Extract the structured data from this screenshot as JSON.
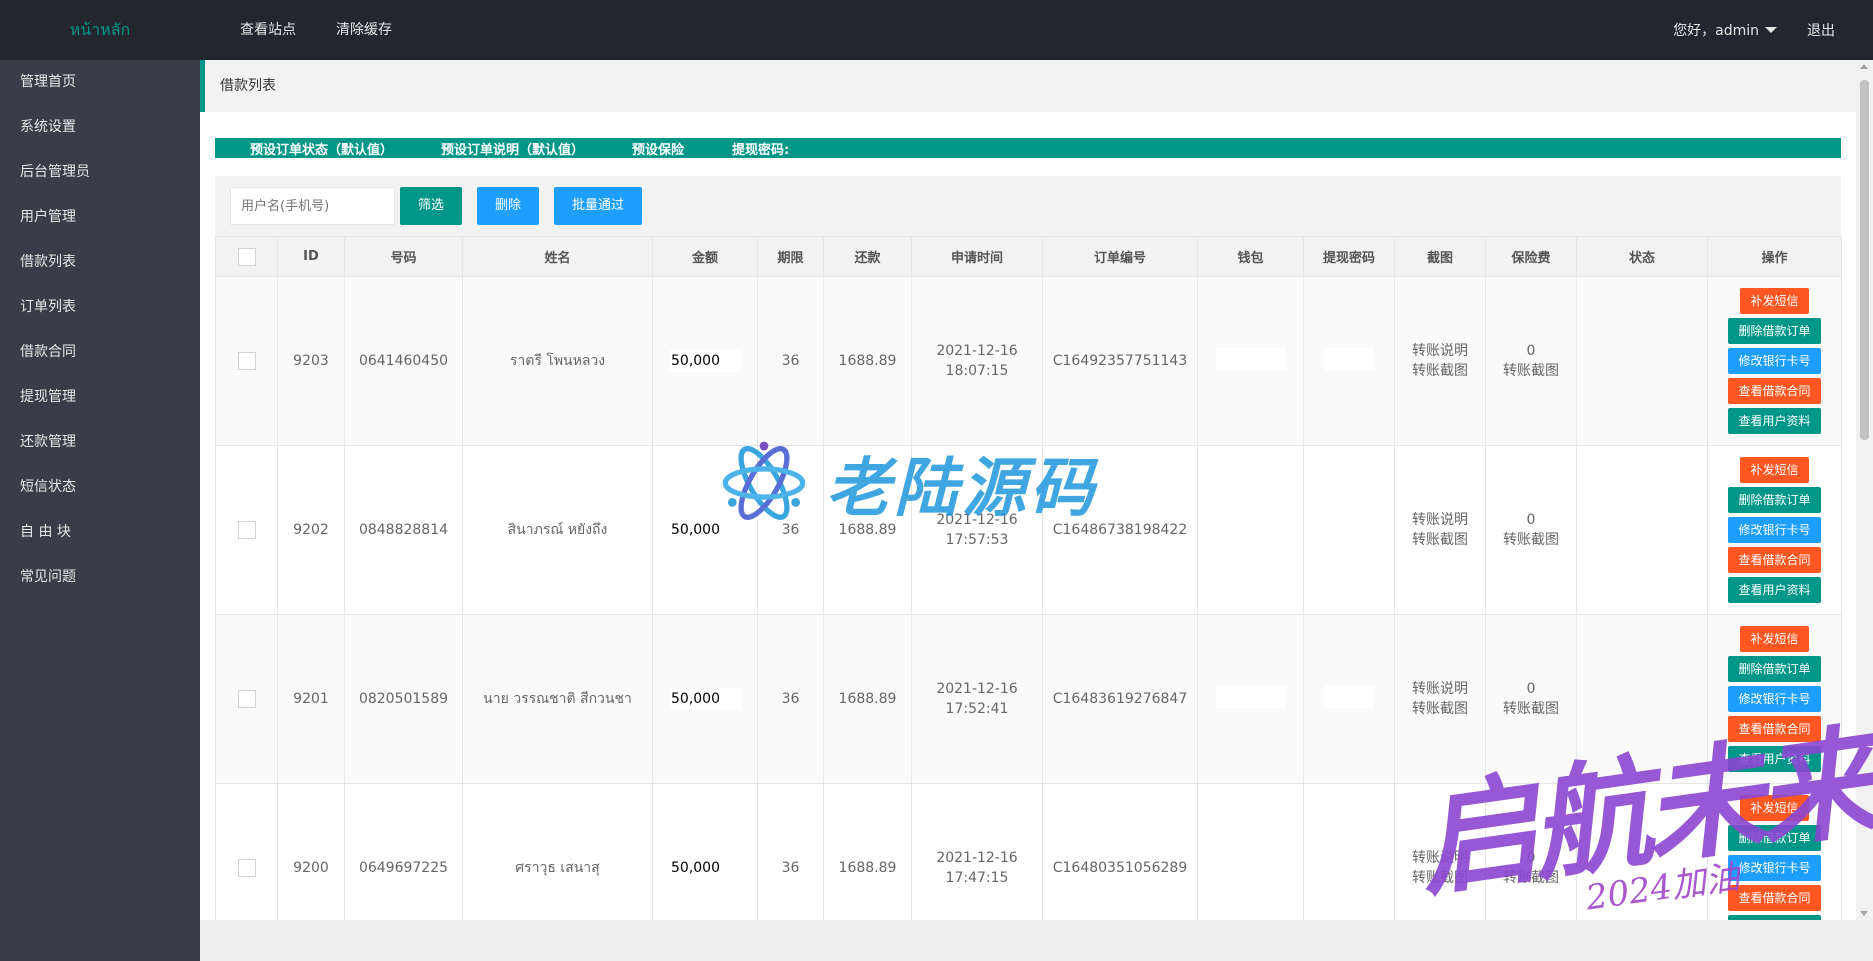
{
  "header": {
    "logo": "หน้าหลัก",
    "nav": [
      "查看站点",
      "清除缓存"
    ],
    "greeting": "您好，admin",
    "logout": "退出"
  },
  "sidebar": {
    "items": [
      {
        "label": "管理首页"
      },
      {
        "label": "系统设置"
      },
      {
        "label": "后台管理员"
      },
      {
        "label": "用户管理"
      },
      {
        "label": "借款列表"
      },
      {
        "label": "订单列表"
      },
      {
        "label": "借款合同"
      },
      {
        "label": "提现管理"
      },
      {
        "label": "还款管理"
      },
      {
        "label": "短信状态"
      },
      {
        "label": "自 由 块"
      },
      {
        "label": "常见问题"
      }
    ]
  },
  "breadcrumb": "借款列表",
  "presets": [
    "预设订单状态（默认值）",
    "预设订单说明（默认值）",
    "预设保险",
    "提现密码:"
  ],
  "filter": {
    "placeholder": "用户名(手机号)",
    "filter_label": "筛选",
    "delete_label": "删除",
    "batch_label": "批量通过"
  },
  "table": {
    "columns": [
      "ID",
      "号码",
      "姓名",
      "金额",
      "期限",
      "还款",
      "申请时间",
      "订单编号",
      "钱包",
      "提现密码",
      "截图",
      "保险费",
      "状态",
      "操作"
    ],
    "rows": [
      {
        "id": "9203",
        "phone": "0641460450",
        "name": "ราตรี โพนหลวง",
        "amount": "50,000",
        "term": "36",
        "repay": "1688.89",
        "date": "2021-12-16",
        "time": "18:07:15",
        "order_no": "C16492357751143",
        "shot1": "转账说明",
        "shot2": "转账截图",
        "fee": "0",
        "fee_shot": "转账截图"
      },
      {
        "id": "9202",
        "phone": "0848828814",
        "name": "สินาภรณ์ หยังถึง",
        "amount": "50,000",
        "term": "36",
        "repay": "1688.89",
        "date": "2021-12-16",
        "time": "17:57:53",
        "order_no": "C16486738198422",
        "shot1": "转账说明",
        "shot2": "转账截图",
        "fee": "0",
        "fee_shot": "转账截图"
      },
      {
        "id": "9201",
        "phone": "0820501589",
        "name": "นาย วรรณชาติ สีกวนชา",
        "amount": "50,000",
        "term": "36",
        "repay": "1688.89",
        "date": "2021-12-16",
        "time": "17:52:41",
        "order_no": "C16483619276847",
        "shot1": "转账说明",
        "shot2": "转账截图",
        "fee": "0",
        "fee_shot": "转账截图"
      },
      {
        "id": "9200",
        "phone": "0649697225",
        "name": "ศราวุธ เสนาสุ",
        "amount": "50,000",
        "term": "36",
        "repay": "1688.89",
        "date": "2021-12-16",
        "time": "17:47:15",
        "order_no": "C16480351056289",
        "shot1": "转账说明",
        "shot2": "转账截图",
        "fee": "0",
        "fee_shot": "转账截图"
      }
    ],
    "actions": [
      "补发短信",
      "删除借款订单",
      "修改银行卡号",
      "查看借款合同",
      "查看用户资料"
    ]
  },
  "watermarks": {
    "center": "老陆源码",
    "corner": "启航未来",
    "corner_year": "2024加油"
  },
  "colors": {
    "header_bg": "#23262e",
    "sidebar_bg": "#393d49",
    "primary_green": "#009688",
    "primary_blue": "#1e9fff",
    "warn_orange": "#ff5722"
  }
}
